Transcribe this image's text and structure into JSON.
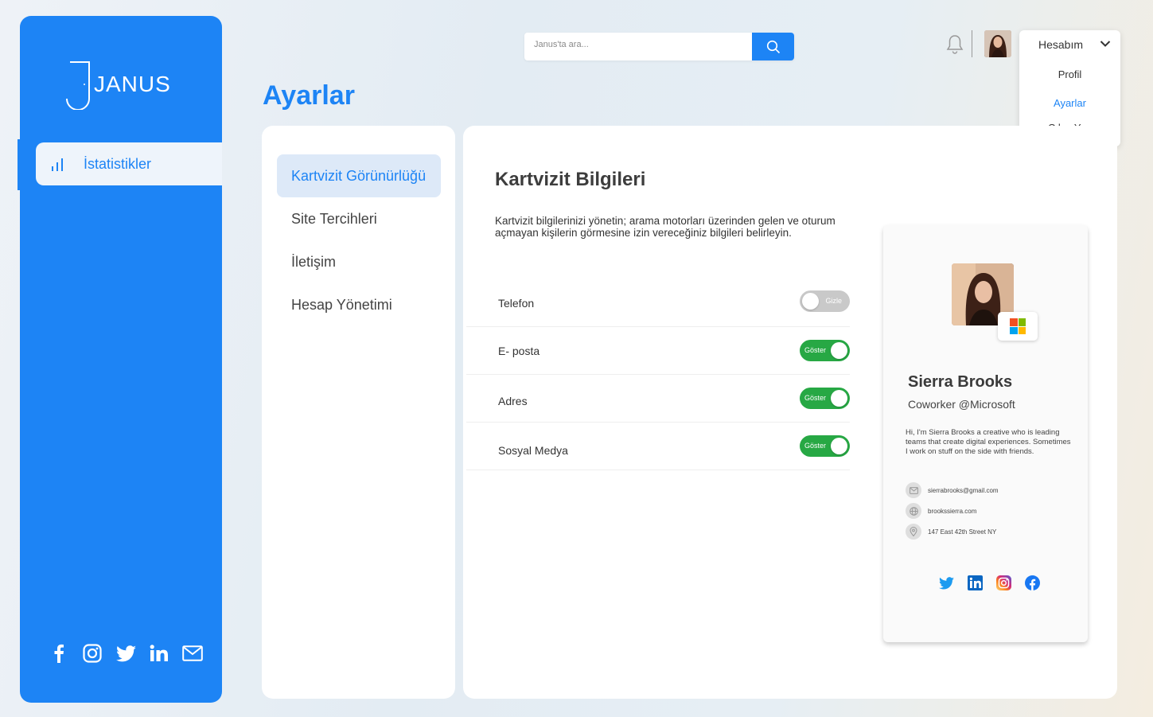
{
  "app": {
    "name": "JANUS"
  },
  "sidebar": {
    "items": [
      {
        "label": "İstatistikler",
        "icon": "bar-chart-icon"
      }
    ],
    "socials": [
      "facebook-icon",
      "instagram-icon",
      "twitter-icon",
      "linkedin-icon",
      "mail-icon"
    ]
  },
  "header": {
    "search": {
      "placeholder": "Janus'ta ara..."
    },
    "account": {
      "label": "Hesabım",
      "items": [
        "Profil",
        "Ayarlar",
        "Çıkış Yap"
      ],
      "active_item": "Ayarlar"
    }
  },
  "page": {
    "title": "Ayarlar"
  },
  "settings_menu": {
    "items": [
      "Kartvizit Görünürlüğü",
      "Site Tercihleri",
      "İletişim",
      "Hesap Yönetimi"
    ],
    "active": "Kartvizit Görünürlüğü"
  },
  "main": {
    "title": "Kartvizit Bilgileri",
    "description": "Kartvizit bilgilerinizi yönetin; arama motorları üzerinden gelen ve oturum açmayan kişilerin görmesine izin vereceğiniz bilgileri belirleyin.",
    "rows": [
      {
        "label": "Telefon",
        "toggle_text": "Gizle",
        "on": false
      },
      {
        "label": "E- posta",
        "toggle_text": "Göster",
        "on": true
      },
      {
        "label": "Adres",
        "toggle_text": "Göster",
        "on": true
      },
      {
        "label": "Sosyal Medya",
        "toggle_text": "Göster",
        "on": true
      }
    ]
  },
  "card": {
    "name": "Sierra Brooks",
    "role": "Coworker @Microsoft",
    "bio": "Hi, I'm Sierra Brooks a creative who is leading teams that create digital experiences. Sometimes I work on stuff on the side with friends.",
    "email": "sierrabrooks@gmail.com",
    "website": "brookssierra.com",
    "address": "147 East 42th Street NY",
    "socials": [
      "twitter-icon",
      "linkedin-icon",
      "instagram-icon",
      "facebook-icon"
    ]
  },
  "colors": {
    "accent": "#1d84f5",
    "toggle_on": "#27a844",
    "toggle_off": "#c9c9c9"
  }
}
